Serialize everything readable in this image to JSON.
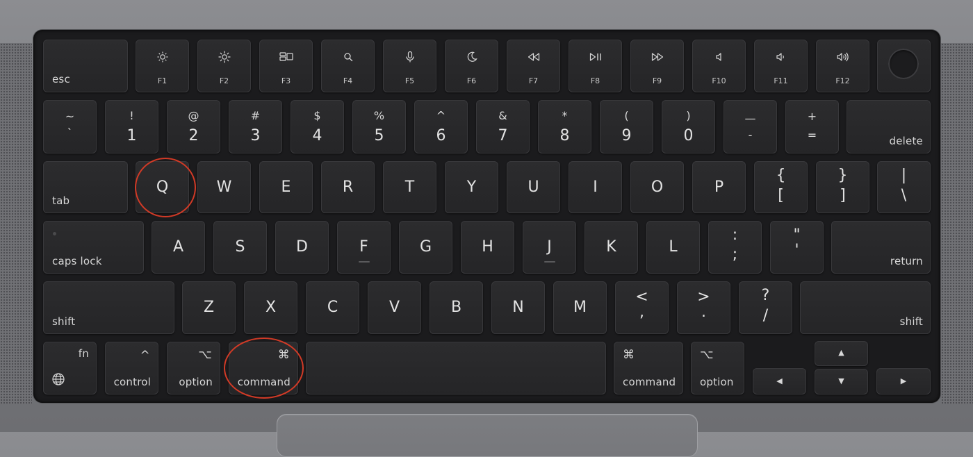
{
  "function_row": {
    "esc": "esc",
    "keys": [
      {
        "label": "F1",
        "icon": "brightness-down-icon"
      },
      {
        "label": "F2",
        "icon": "brightness-up-icon"
      },
      {
        "label": "F3",
        "icon": "mission-control-icon"
      },
      {
        "label": "F4",
        "icon": "spotlight-search-icon"
      },
      {
        "label": "F5",
        "icon": "dictation-microphone-icon"
      },
      {
        "label": "F6",
        "icon": "do-not-disturb-moon-icon"
      },
      {
        "label": "F7",
        "icon": "rewind-icon"
      },
      {
        "label": "F8",
        "icon": "play-pause-icon"
      },
      {
        "label": "F9",
        "icon": "fast-forward-icon"
      },
      {
        "label": "F10",
        "icon": "mute-icon"
      },
      {
        "label": "F11",
        "icon": "volume-down-icon"
      },
      {
        "label": "F12",
        "icon": "volume-up-icon"
      }
    ]
  },
  "number_row": {
    "backtick": {
      "top": "~",
      "bottom": "`"
    },
    "keys": [
      {
        "top": "!",
        "bottom": "1"
      },
      {
        "top": "@",
        "bottom": "2"
      },
      {
        "top": "#",
        "bottom": "3"
      },
      {
        "top": "$",
        "bottom": "4"
      },
      {
        "top": "%",
        "bottom": "5"
      },
      {
        "top": "^",
        "bottom": "6"
      },
      {
        "top": "&",
        "bottom": "7"
      },
      {
        "top": "*",
        "bottom": "8"
      },
      {
        "top": "(",
        "bottom": "9"
      },
      {
        "top": ")",
        "bottom": "0"
      },
      {
        "top": "—",
        "bottom": "-"
      },
      {
        "top": "+",
        "bottom": "="
      }
    ],
    "delete": "delete"
  },
  "qwerty_row": {
    "tab": "tab",
    "letters": [
      "Q",
      "W",
      "E",
      "R",
      "T",
      "Y",
      "U",
      "I",
      "O",
      "P"
    ],
    "bracket_left": {
      "top": "{",
      "bottom": "["
    },
    "bracket_right": {
      "top": "}",
      "bottom": "]"
    },
    "backslash": {
      "top": "|",
      "bottom": "\\"
    }
  },
  "home_row": {
    "caps": "caps lock",
    "letters": [
      "A",
      "S",
      "D",
      "F",
      "G",
      "H",
      "J",
      "K",
      "L"
    ],
    "semicolon": {
      "top": ":",
      "bottom": ";"
    },
    "quote": {
      "top": "\"",
      "bottom": "'"
    },
    "return": "return"
  },
  "bottom_row": {
    "shift_left": "shift",
    "letters": [
      "Z",
      "X",
      "C",
      "V",
      "B",
      "N",
      "M"
    ],
    "comma": {
      "top": "<",
      "bottom": ","
    },
    "period": {
      "top": ">",
      "bottom": "."
    },
    "slash": {
      "top": "?",
      "bottom": "/"
    },
    "shift_right": "shift"
  },
  "modifier_row": {
    "fn": "fn",
    "control": {
      "symbol": "^",
      "label": "control"
    },
    "option_left": {
      "symbol": "⌥",
      "label": "option"
    },
    "command_left": {
      "symbol": "⌘",
      "label": "command"
    },
    "command_right": {
      "symbol": "⌘",
      "label": "command"
    },
    "option_right": {
      "symbol": "⌥",
      "label": "option"
    },
    "arrows": {
      "up": "▲",
      "down": "▼",
      "left": "◀",
      "right": "▶"
    }
  },
  "highlights": {
    "color": "#d23a26",
    "keys": [
      "Q",
      "command"
    ]
  }
}
